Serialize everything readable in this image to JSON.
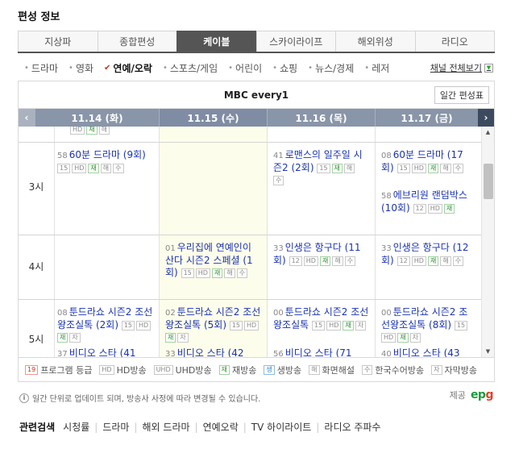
{
  "page": {
    "title": "편성 정보"
  },
  "main_tabs": [
    {
      "label": "지상파",
      "active": false
    },
    {
      "label": "종합편성",
      "active": false
    },
    {
      "label": "케이블",
      "active": true
    },
    {
      "label": "스카이라이프",
      "active": false
    },
    {
      "label": "해외위성",
      "active": false
    },
    {
      "label": "라디오",
      "active": false
    }
  ],
  "subnav": {
    "items": [
      {
        "label": "드라마",
        "active": false
      },
      {
        "label": "영화",
        "active": false
      },
      {
        "label": "연예/오락",
        "active": true
      },
      {
        "label": "스포츠/게임",
        "active": false
      },
      {
        "label": "어린이",
        "active": false
      },
      {
        "label": "쇼핑",
        "active": false
      },
      {
        "label": "뉴스/경제",
        "active": false
      },
      {
        "label": "레저",
        "active": false
      }
    ],
    "all_channels": "채널 전체보기"
  },
  "schedule": {
    "channel": "MBC every1",
    "weekly_button": "일간 편성표",
    "dates": [
      {
        "label": "11.14 (화)",
        "today": false
      },
      {
        "label": "11.15 (수)",
        "today": true
      },
      {
        "label": "11.16 (목)",
        "today": false
      },
      {
        "label": "11.17 (금)",
        "today": false
      }
    ],
    "hours": [
      "3시",
      "4시",
      "5시"
    ],
    "top_badges": [
      "HD",
      "재",
      "해"
    ],
    "programs": [
      {
        "time": "58",
        "title": "60분 드라마 (9회)",
        "badges": [
          "15",
          "HD",
          "재",
          "해",
          "수"
        ]
      },
      {
        "time": "41",
        "title": "로맨스의 일주일 시즌2 (2회)",
        "badges": [
          "15",
          "재",
          "해",
          "수"
        ]
      },
      {
        "time": "08",
        "title": "60분 드라마 (17회)",
        "badges": [
          "15",
          "HD",
          "재",
          "해",
          "수"
        ]
      },
      {
        "time": "58",
        "title": "에브리원 랜덤박스 (10회)",
        "badges": [
          "12",
          "HD",
          "재"
        ]
      },
      {
        "time": "01",
        "title": "우리집에 연예인이 산다 시즌2 스페셜 (1회)",
        "badges": [
          "15",
          "HD",
          "재",
          "해",
          "수"
        ]
      },
      {
        "time": "33",
        "title": "인생은 항구다 (11회)",
        "badges": [
          "12",
          "HD",
          "재",
          "해",
          "수"
        ]
      },
      {
        "time": "33",
        "title": "인생은 항구다 (12회)",
        "badges": [
          "12",
          "HD",
          "재",
          "해",
          "수"
        ]
      },
      {
        "time": "08",
        "title": "툰드라쇼 시즌2 조선왕조실톡 (2회)",
        "badges": [
          "15",
          "HD",
          "재",
          "자"
        ]
      },
      {
        "time": "02",
        "title": "툰드라쇼 시즌2 조선왕조실톡 (5회)",
        "badges": [
          "15",
          "HD",
          "재",
          "자"
        ]
      },
      {
        "time": "00",
        "title": "툰드라쇼 시즌2 조선왕조실톡",
        "badges": [
          "15",
          "HD",
          "재",
          "자"
        ]
      },
      {
        "time": "00",
        "title": "툰드라쇼 시즌2 조선왕조실톡 (8회)",
        "badges": [
          "15",
          "HD",
          "재",
          "자"
        ]
      },
      {
        "time": "37",
        "title": "비디오 스타 (41",
        "badges": []
      },
      {
        "time": "33",
        "title": "비디오 스타 (42",
        "badges": []
      },
      {
        "time": "56",
        "title": "비디오 스타 (71",
        "badges": []
      },
      {
        "time": "40",
        "title": "비디오 스타 (43",
        "badges": []
      }
    ]
  },
  "legend": [
    {
      "badge": "19",
      "label": "프로그램 등급"
    },
    {
      "badge": "HD",
      "label": "HD방송"
    },
    {
      "badge": "UHD",
      "label": "UHD방송"
    },
    {
      "badge": "재",
      "label": "재방송"
    },
    {
      "badge": "생",
      "label": "생방송"
    },
    {
      "badge": "해",
      "label": "화면해설"
    },
    {
      "badge": "수",
      "label": "한국수어방송"
    },
    {
      "badge": "자",
      "label": "자막방송"
    }
  ],
  "notice": "일간 단위로 업데이트 되며, 방송사 사정에 따라 변경될 수 있습니다.",
  "provider": {
    "label": "제공",
    "logo_main": "ep",
    "logo_accent": "g"
  },
  "related": {
    "title": "관련검색",
    "links": [
      "시청률",
      "드라마",
      "해외 드라마",
      "연예오락",
      "TV 하이라이트",
      "라디오 주파수"
    ]
  },
  "colors": {
    "link": "#1a33b4",
    "accent_check": "#d0321b",
    "header_bar": "#8995a8",
    "today_bg": "#fdfdeb"
  },
  "icons": {
    "prev": "chevron-left-icon",
    "next": "chevron-right-icon",
    "info": "info-icon"
  }
}
